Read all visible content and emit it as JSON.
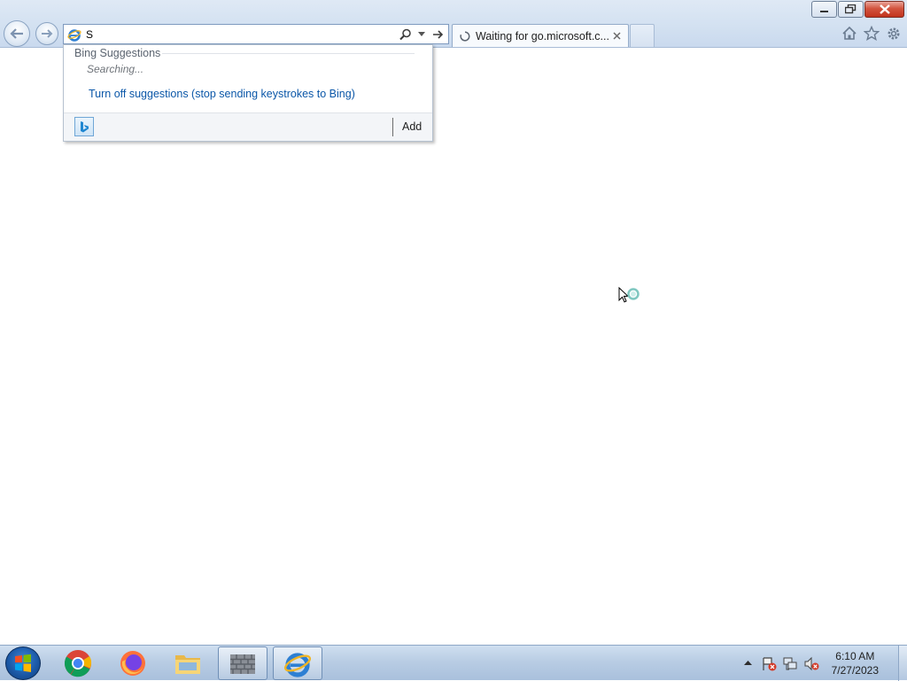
{
  "browser": {
    "address_value": "S",
    "tab_title": "Waiting for go.microsoft.c..."
  },
  "suggestions": {
    "header": "Bing Suggestions",
    "status": "Searching...",
    "turn_off_link": "Turn off suggestions (stop sending keystrokes to Bing)",
    "add_label": "Add"
  },
  "taskbar": {
    "apps": [
      "chrome-icon",
      "firefox-icon",
      "file-explorer-icon",
      "firewall-icon",
      "internet-explorer-icon"
    ],
    "time": "6:10 AM",
    "date": "7/27/2023"
  },
  "colors": {
    "link": "#0b57a8",
    "close_button": "#c2331c",
    "frame": "#d3e1f1"
  }
}
